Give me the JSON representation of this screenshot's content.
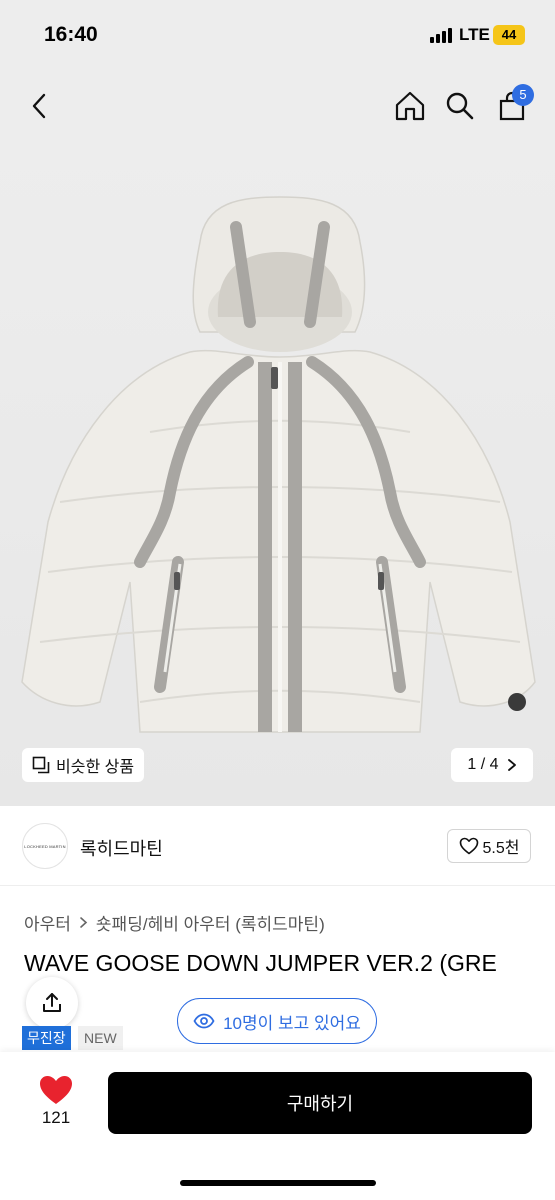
{
  "status_bar": {
    "time": "16:40",
    "network": "LTE",
    "battery": "44"
  },
  "nav": {
    "cart_count": "5"
  },
  "gallery": {
    "similar_label": "비슷한 상품",
    "pager_text": "1 / 4"
  },
  "brand": {
    "logo_text": "LOCKHEED MARTIN",
    "name": "록히드마틴",
    "like_count": "5.5천"
  },
  "product": {
    "category_main": "아우터",
    "category_sub": "숏패딩/헤비 아우터 (록히드마틴)",
    "title": "WAVE GOOSE DOWN JUMPER VER.2 (GRE",
    "tag_store": "무진장",
    "tag_new": "NEW"
  },
  "viewers": {
    "label": "10명이 보고 있어요"
  },
  "bottom": {
    "like_count": "121",
    "buy_label": "구매하기"
  },
  "colors": {
    "accent_blue": "#2f6de1",
    "heart_red": "#e8232e",
    "buy_button": "#000000"
  }
}
